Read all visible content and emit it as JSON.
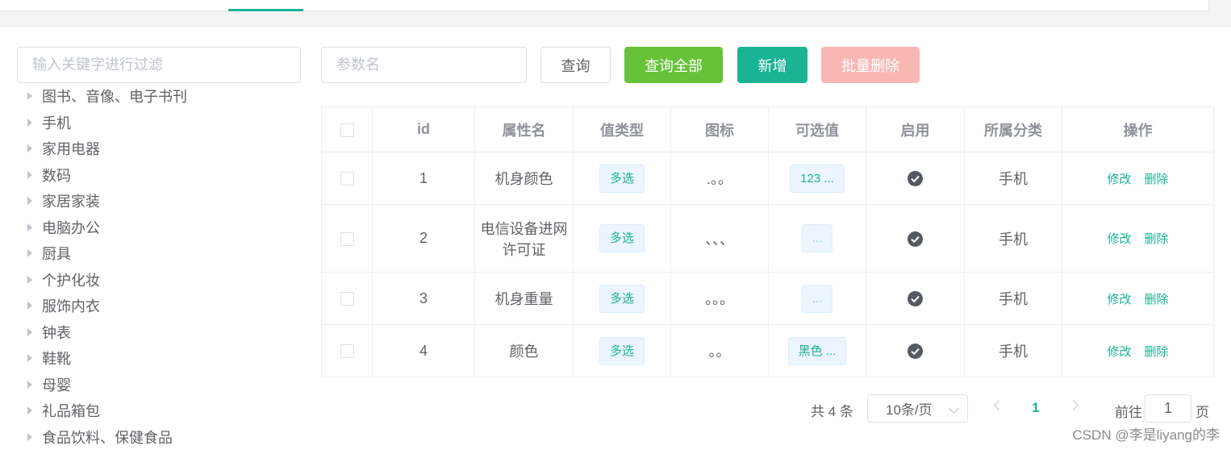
{
  "sidebar": {
    "filter_placeholder": "输入关键字进行过滤",
    "categories": [
      "图书、音像、电子书刊",
      "手机",
      "家用电器",
      "数码",
      "家居家装",
      "电脑办公",
      "厨具",
      "个护化妆",
      "服饰内衣",
      "钟表",
      "鞋靴",
      "母婴",
      "礼品箱包",
      "食品饮料、保健食品"
    ]
  },
  "toolbar": {
    "param_placeholder": "参数名",
    "query_label": "查询",
    "query_all_label": "查询全部",
    "add_label": "新增",
    "batch_delete_label": "批量删除"
  },
  "table": {
    "headers": [
      "id",
      "属性名",
      "值类型",
      "图标",
      "可选值",
      "启用",
      "所属分类",
      "操作"
    ],
    "rows": [
      {
        "id": "1",
        "name": "机身颜色",
        "type": "多选",
        "icon": ".。。",
        "values": "123 ...",
        "enabled": true,
        "category": "手机"
      },
      {
        "id": "2",
        "name": "电信设备进网许可证",
        "type": "多选",
        "icon": "、、、",
        "values": "...",
        "enabled": true,
        "category": "手机"
      },
      {
        "id": "3",
        "name": "机身重量",
        "type": "多选",
        "icon": "。。。",
        "values": "...",
        "enabled": true,
        "category": "手机"
      },
      {
        "id": "4",
        "name": "颜色",
        "type": "多选",
        "icon": "。。",
        "values": "黑色 ...",
        "enabled": true,
        "category": "手机"
      }
    ],
    "edit_label": "修改",
    "delete_label": "删除"
  },
  "pagination": {
    "total_text": "共 4 条",
    "page_size": "10条/页",
    "current_page": "1",
    "goto_label": "前往",
    "goto_value": "1",
    "page_suffix": "页"
  },
  "watermark": "CSDN @李是liyang的李",
  "colors": {
    "accent": "#1ab394",
    "success": "#67c23a",
    "danger_disabled": "#f9b7b4"
  }
}
